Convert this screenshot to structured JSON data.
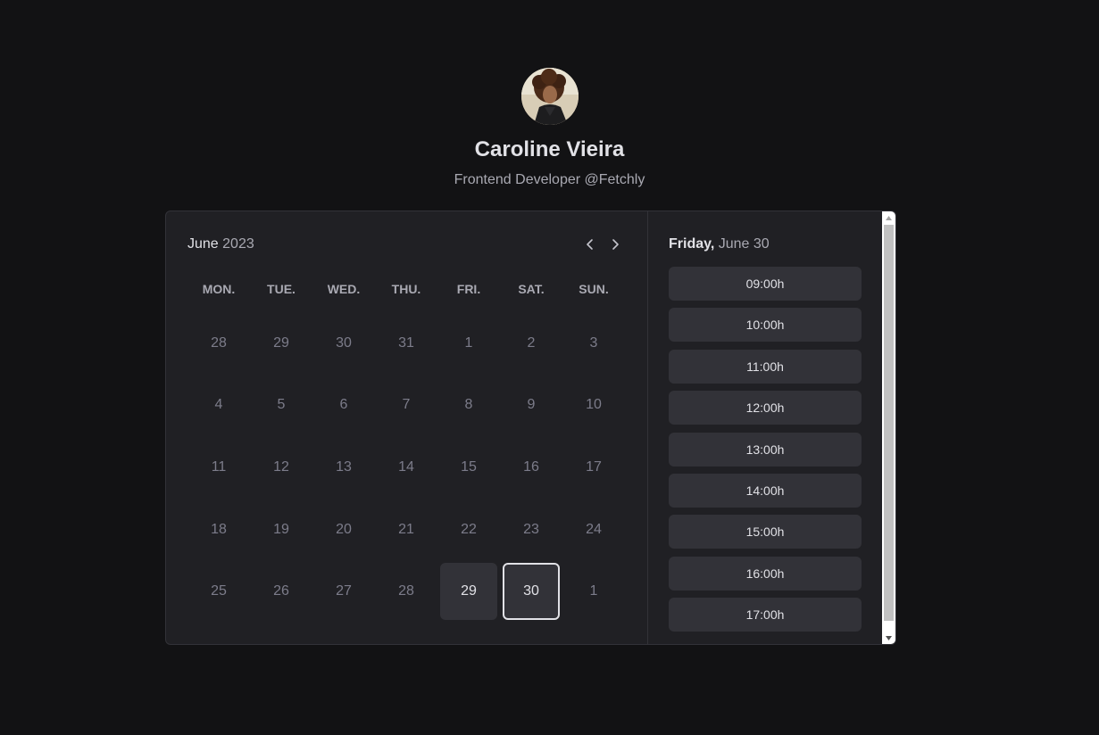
{
  "profile": {
    "name": "Caroline Vieira",
    "role": "Frontend Developer @Fetchly"
  },
  "calendar": {
    "month": "June",
    "year": "2023",
    "weekdays": [
      "MON.",
      "TUE.",
      "WED.",
      "THU.",
      "FRI.",
      "SAT.",
      "SUN."
    ],
    "days": [
      {
        "label": "28",
        "state": "disabled"
      },
      {
        "label": "29",
        "state": "disabled"
      },
      {
        "label": "30",
        "state": "disabled"
      },
      {
        "label": "31",
        "state": "disabled"
      },
      {
        "label": "1",
        "state": "disabled"
      },
      {
        "label": "2",
        "state": "disabled"
      },
      {
        "label": "3",
        "state": "disabled"
      },
      {
        "label": "4",
        "state": "disabled"
      },
      {
        "label": "5",
        "state": "disabled"
      },
      {
        "label": "6",
        "state": "disabled"
      },
      {
        "label": "7",
        "state": "disabled"
      },
      {
        "label": "8",
        "state": "disabled"
      },
      {
        "label": "9",
        "state": "disabled"
      },
      {
        "label": "10",
        "state": "disabled"
      },
      {
        "label": "11",
        "state": "disabled"
      },
      {
        "label": "12",
        "state": "disabled"
      },
      {
        "label": "13",
        "state": "disabled"
      },
      {
        "label": "14",
        "state": "disabled"
      },
      {
        "label": "15",
        "state": "disabled"
      },
      {
        "label": "16",
        "state": "disabled"
      },
      {
        "label": "17",
        "state": "disabled"
      },
      {
        "label": "18",
        "state": "disabled"
      },
      {
        "label": "19",
        "state": "disabled"
      },
      {
        "label": "20",
        "state": "disabled"
      },
      {
        "label": "21",
        "state": "disabled"
      },
      {
        "label": "22",
        "state": "disabled"
      },
      {
        "label": "23",
        "state": "disabled"
      },
      {
        "label": "24",
        "state": "disabled"
      },
      {
        "label": "25",
        "state": "disabled"
      },
      {
        "label": "26",
        "state": "disabled"
      },
      {
        "label": "27",
        "state": "disabled"
      },
      {
        "label": "28",
        "state": "disabled"
      },
      {
        "label": "29",
        "state": "available"
      },
      {
        "label": "30",
        "state": "selected"
      },
      {
        "label": "1",
        "state": "disabled"
      }
    ]
  },
  "slots": {
    "weekday": "Friday,",
    "date": "June 30",
    "times": [
      "09:00h",
      "10:00h",
      "11:00h",
      "12:00h",
      "13:00h",
      "14:00h",
      "15:00h",
      "16:00h",
      "17:00h"
    ]
  },
  "icons": {
    "prev": "chevron-left-icon",
    "next": "chevron-right-icon"
  },
  "colors": {
    "background": "#121214",
    "card": "#202024",
    "border": "#323238",
    "button": "#323238",
    "text": "#e1e1e6",
    "muted": "#a9a9b2",
    "disabled": "#7c7c8a"
  }
}
